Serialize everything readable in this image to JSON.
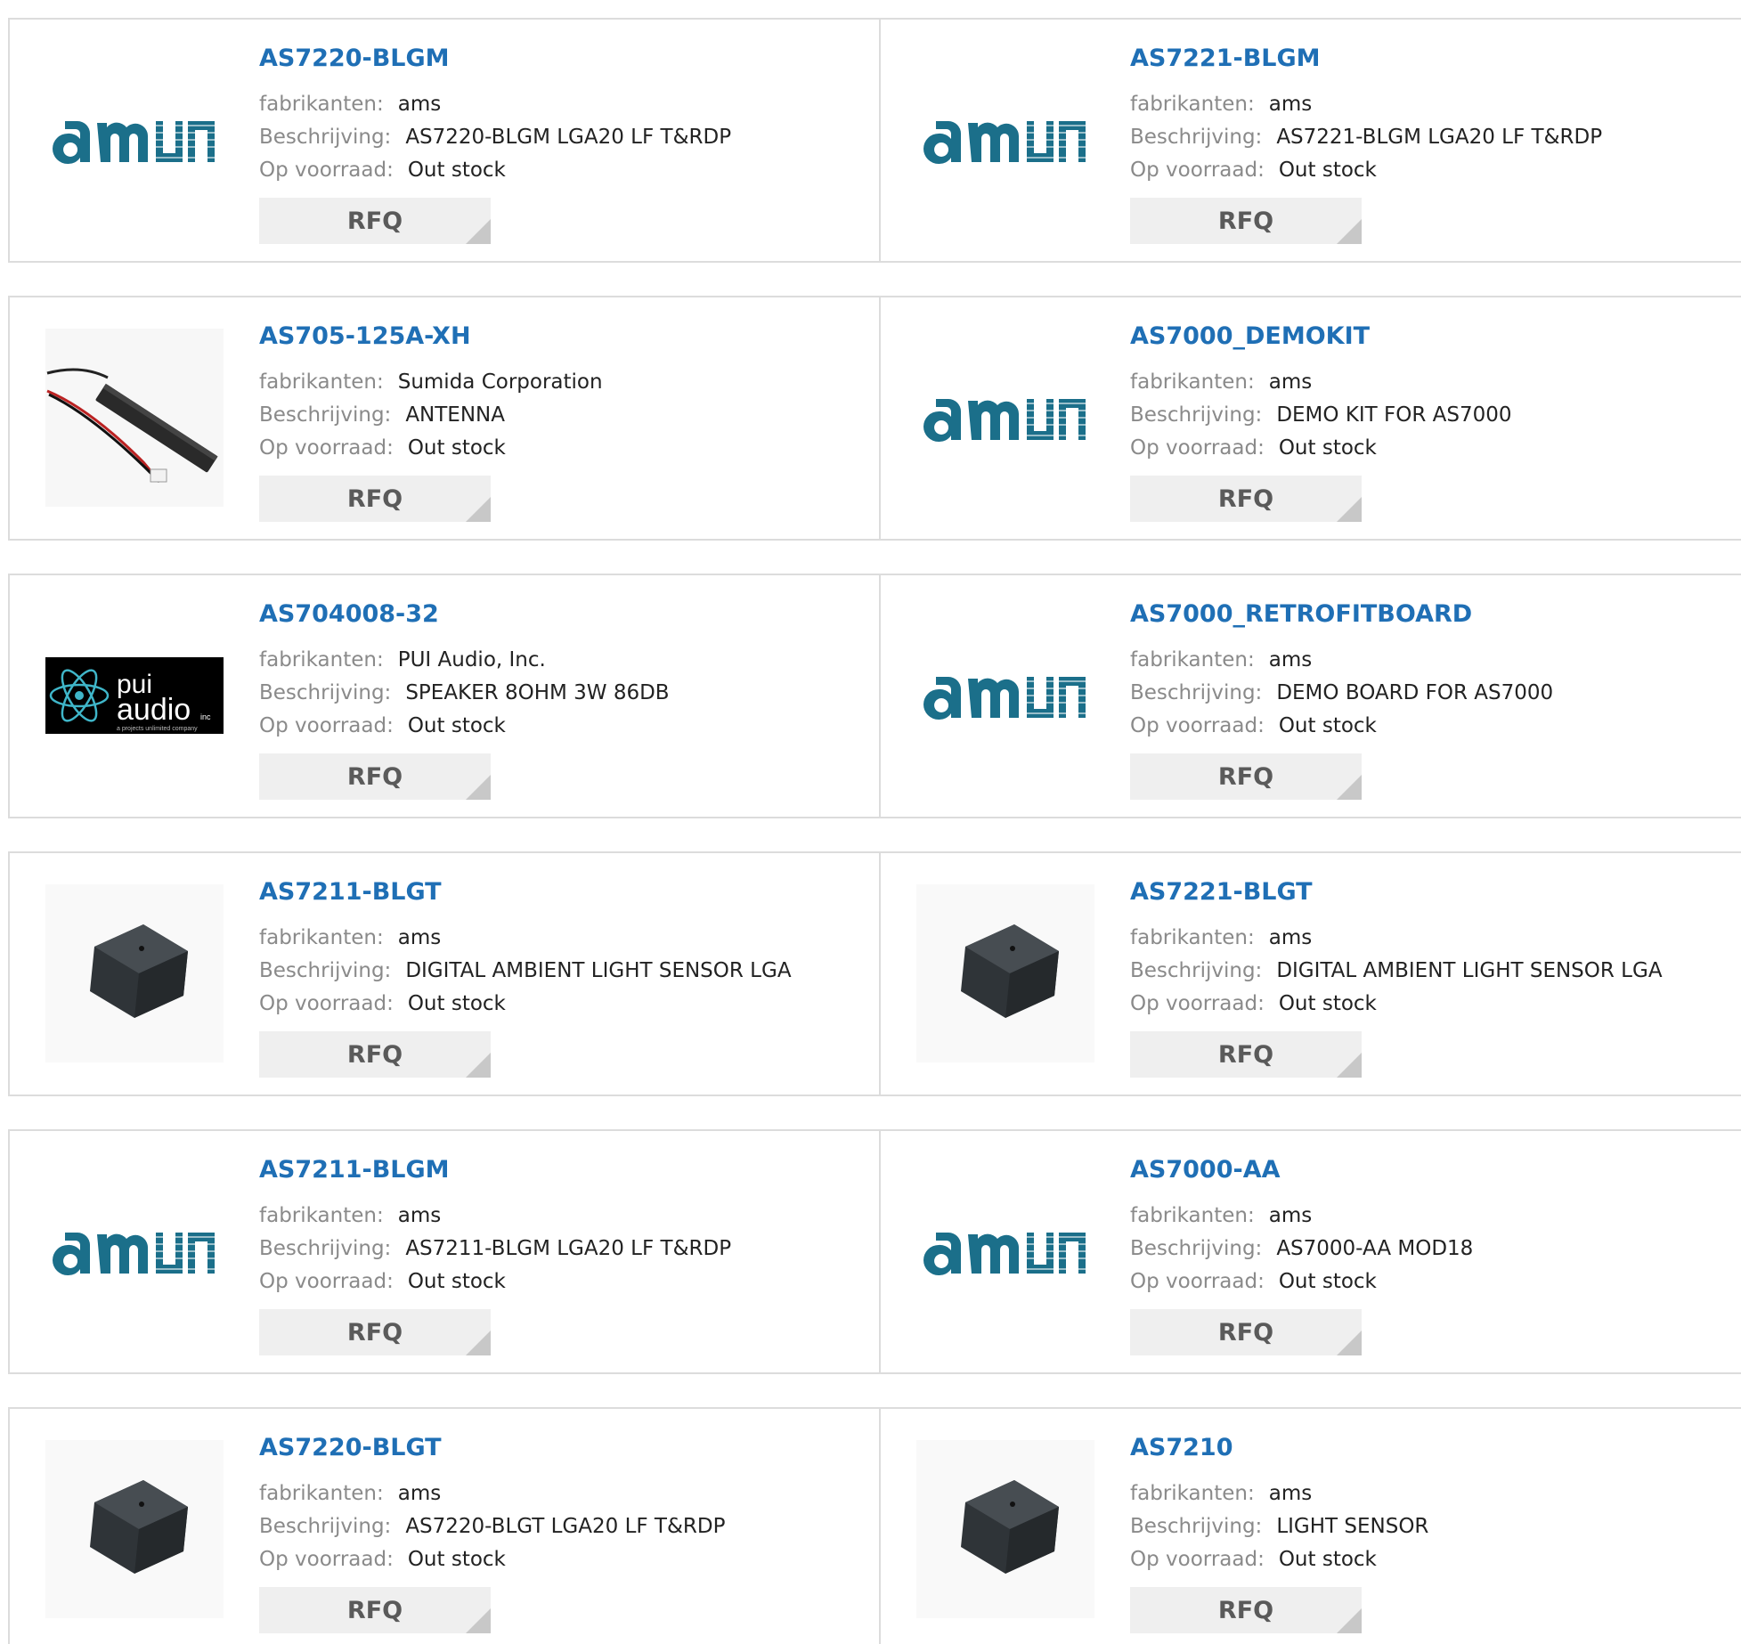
{
  "labels": {
    "manufacturer": "fabrikanten:",
    "description": "Beschrijving:",
    "stock": "Op voorraad:",
    "rfq": "RFQ"
  },
  "colors": {
    "part_link": "#1f6fb5",
    "ams_logo": "#1b6f8a",
    "rfq_bg": "#efefef"
  },
  "rows": [
    [
      {
        "part": "AS7220-BLGM",
        "manufacturer": "ams",
        "description": "AS7220-BLGM LGA20 LF T&RDP",
        "stock": "Out stock",
        "image": "ams-logo"
      },
      {
        "part": "AS7221-BLGM",
        "manufacturer": "ams",
        "description": "AS7221-BLGM LGA20 LF T&RDP",
        "stock": "Out stock",
        "image": "ams-logo"
      }
    ],
    [
      {
        "part": "AS705-125A-XH",
        "manufacturer": "Sumida Corporation",
        "description": "ANTENNA",
        "stock": "Out stock",
        "image": "antenna-photo"
      },
      {
        "part": "AS7000_DEMOKIT",
        "manufacturer": "ams",
        "description": "DEMO KIT FOR AS7000",
        "stock": "Out stock",
        "image": "ams-logo"
      }
    ],
    [
      {
        "part": "AS704008-32",
        "manufacturer": "PUI Audio, Inc.",
        "description": "SPEAKER 8OHM 3W 86DB",
        "stock": "Out stock",
        "image": "pui-audio-logo"
      },
      {
        "part": "AS7000_RETROFITBOARD",
        "manufacturer": "ams",
        "description": "DEMO BOARD FOR AS7000",
        "stock": "Out stock",
        "image": "ams-logo"
      }
    ],
    [
      {
        "part": "AS7211-BLGT",
        "manufacturer": "ams",
        "description": "DIGITAL AMBIENT LIGHT SENSOR LGA",
        "stock": "Out stock",
        "image": "chip-photo"
      },
      {
        "part": "AS7221-BLGT",
        "manufacturer": "ams",
        "description": "DIGITAL AMBIENT LIGHT SENSOR LGA",
        "stock": "Out stock",
        "image": "chip-photo"
      }
    ],
    [
      {
        "part": "AS7211-BLGM",
        "manufacturer": "ams",
        "description": "AS7211-BLGM LGA20 LF T&RDP",
        "stock": "Out stock",
        "image": "ams-logo"
      },
      {
        "part": "AS7000-AA",
        "manufacturer": "ams",
        "description": "AS7000-AA MOD18",
        "stock": "Out stock",
        "image": "ams-logo"
      }
    ],
    [
      {
        "part": "AS7220-BLGT",
        "manufacturer": "ams",
        "description": "AS7220-BLGT LGA20 LF T&RDP",
        "stock": "Out stock",
        "image": "chip-photo"
      },
      {
        "part": "AS7210",
        "manufacturer": "ams",
        "description": "LIGHT SENSOR",
        "stock": "Out stock",
        "image": "chip-photo"
      }
    ]
  ]
}
